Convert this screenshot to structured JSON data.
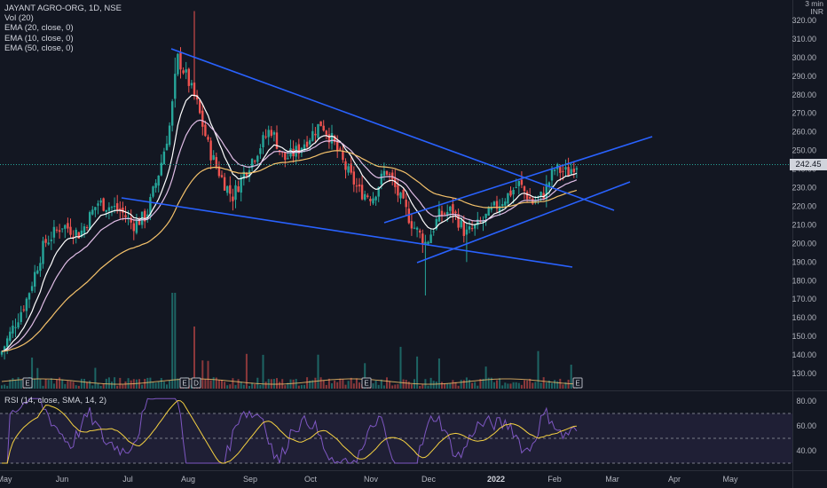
{
  "legend": {
    "symbol": "JAYANT AGRO-ORG, 1D, NSE",
    "vol": "Vol (20)",
    "ema20": "EMA (20, close, 0)",
    "ema10": "EMA (10, close, 0)",
    "ema50": "EMA (50, close, 0)"
  },
  "rsi_legend": "RSI (14, close, SMA, 14, 2)",
  "currency_top": "3 min",
  "currency": "INR",
  "last_price": "242.45",
  "colors": {
    "background": "#131722",
    "up": "#26a69a",
    "down": "#ef5350",
    "trendline": "#2962ff",
    "ema20": "#e1bee7",
    "ema10": "#ffffff",
    "ema50": "#f5c26b",
    "rsi": "#7e57c2",
    "rsi_ma": "#f5d142"
  },
  "chart_data": [
    {
      "type": "candlestick",
      "yaxis_ticks": [
        "320.00",
        "310.00",
        "300.00",
        "290.00",
        "280.00",
        "270.00",
        "260.00",
        "250.00",
        "240.00",
        "230.00",
        "220.00",
        "210.00",
        "200.00",
        "190.00",
        "180.00",
        "170.00",
        "160.00",
        "150.00",
        "140.00",
        "130.00"
      ],
      "ylim": [
        125,
        325
      ],
      "xaxis_ticks": [
        "May",
        "Jun",
        "Jul",
        "Aug",
        "Sep",
        "Oct",
        "Nov",
        "Dec",
        "2022",
        "Feb",
        "Mar",
        "Apr",
        "May"
      ],
      "event_markers": [
        "E",
        "E",
        "D",
        "E",
        "E"
      ],
      "last_price": 242.45,
      "approx_path": {
        "dates": [
          "May",
          "Jun",
          "Jul",
          "late Jul",
          "Aug",
          "Sep",
          "Oct",
          "Nov",
          "Dec",
          "2022",
          "Feb"
        ],
        "close": [
          140,
          205,
          220,
          215,
          300,
          235,
          265,
          230,
          200,
          215,
          242.45
        ]
      },
      "indicators": [
        "Vol (20)",
        "EMA (20, close, 0)",
        "EMA (10, close, 0)",
        "EMA (50, close, 0)"
      ]
    },
    {
      "type": "line",
      "name": "RSI (14, close, SMA, 14, 2)",
      "yaxis_ticks": [
        "80.00",
        "60.00",
        "40.00"
      ],
      "ylim": [
        25,
        85
      ],
      "bands": [
        30,
        50,
        70
      ]
    }
  ]
}
